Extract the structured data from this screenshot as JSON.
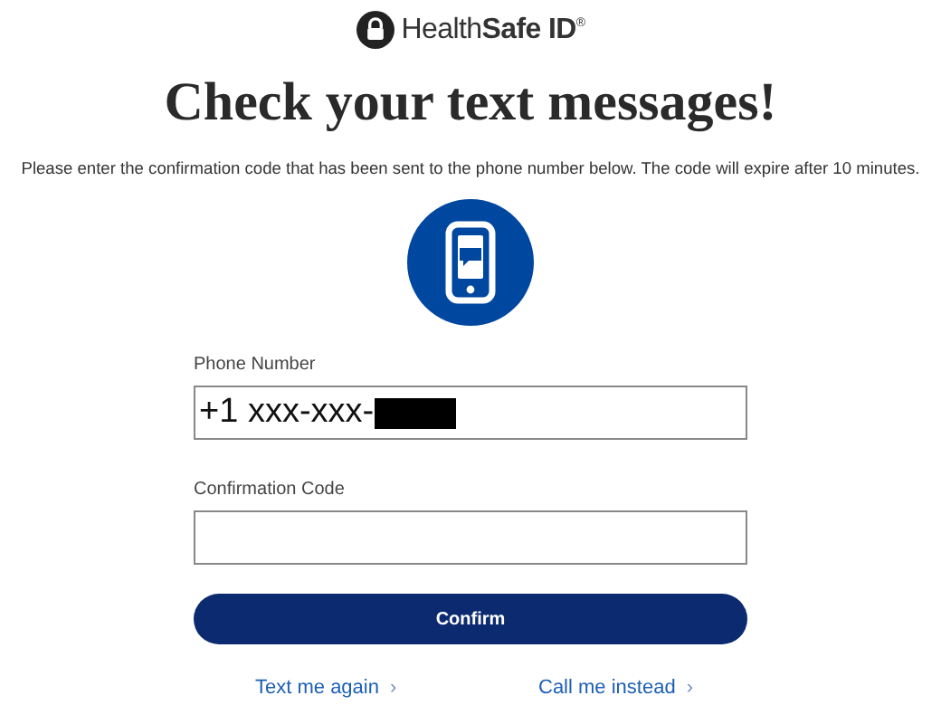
{
  "logo": {
    "text": "Health**Safe ID**$^{®}$"
  },
  "heading": "Check your text messages!",
  "instructions": "Please enter the confirmation code that has been sent to the phone number below. The code will expire after 10 minutes.",
  "fields": [
    {
      "label": "Phone Number",
      "value": "+1 xxx-xxx-",
      "redacted": true
    },
    {
      "label": "Confirmation Code"
    }
  ],
  "confirm_button": "Confirm",
  "links": [
    {
      "text": "Text me again",
      "arrow": "›"
    },
    {
      "text": "Call me instead",
      "arrow": "›"
    }
  ]
}
